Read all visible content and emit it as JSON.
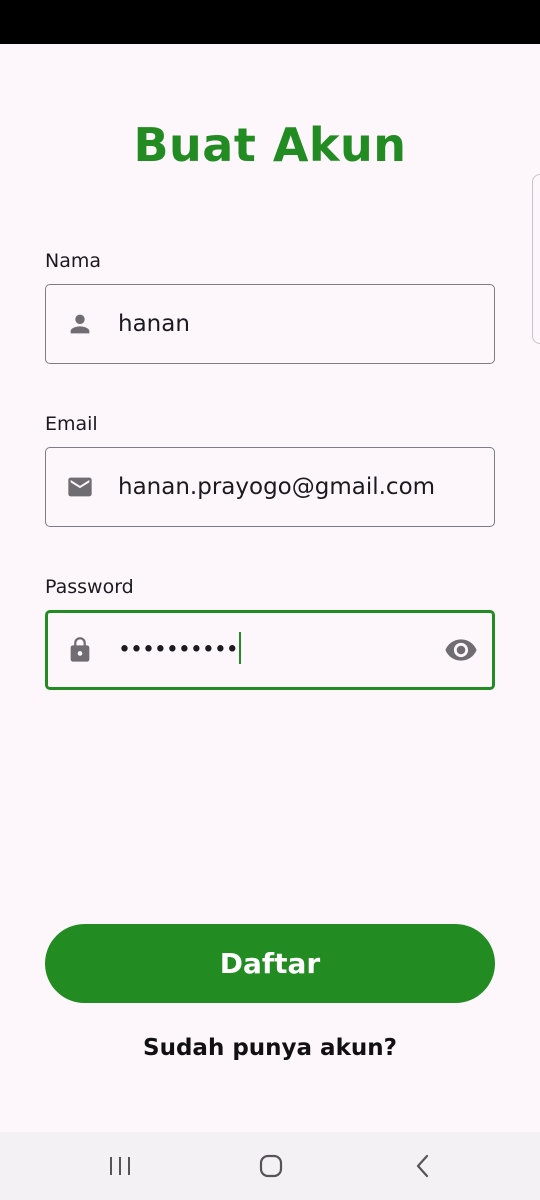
{
  "header": {
    "title": "Buat Akun"
  },
  "form": {
    "name": {
      "label": "Nama",
      "value": "hanan"
    },
    "email": {
      "label": "Email",
      "value": "hanan.prayogo@gmail.com"
    },
    "password": {
      "label": "Password",
      "value": "••••••••••"
    }
  },
  "actions": {
    "register_label": "Daftar",
    "login_link": "Sudah punya akun?"
  },
  "icons": {
    "name": "person-icon",
    "email": "mail-icon",
    "password": "lock-icon",
    "toggle": "eye-icon"
  },
  "colors": {
    "accent": "#228b22",
    "background": "#fdf7fc",
    "icon": "#6f6c72"
  }
}
